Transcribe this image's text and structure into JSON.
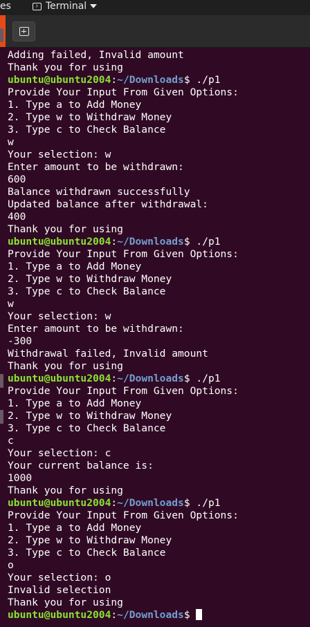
{
  "topbar": {
    "prev_tab_fragment": "es",
    "app_name": "Terminal"
  },
  "prompt": {
    "user_host": "ubuntu@ubuntu2004",
    "colon": ":",
    "path": "~/Downloads",
    "dollar": "$"
  },
  "lines": [
    {
      "type": "text",
      "text": "Adding failed, Invalid amount"
    },
    {
      "type": "text",
      "text": "Thank you for using"
    },
    {
      "type": "prompt",
      "cmd": " ./p1"
    },
    {
      "type": "text",
      "text": "Provide Your Input From Given Options:"
    },
    {
      "type": "text",
      "text": "1. Type a to Add Money"
    },
    {
      "type": "text",
      "text": "2. Type w to Withdraw Money"
    },
    {
      "type": "text",
      "text": "3. Type c to Check Balance"
    },
    {
      "type": "text",
      "text": "w"
    },
    {
      "type": "text",
      "text": "Your selection: w"
    },
    {
      "type": "text",
      "text": "Enter amount to be withdrawn:"
    },
    {
      "type": "text",
      "text": "600"
    },
    {
      "type": "text",
      "text": "Balance withdrawn successfully"
    },
    {
      "type": "text",
      "text": "Updated balance after withdrawal:"
    },
    {
      "type": "text",
      "text": "400"
    },
    {
      "type": "text",
      "text": "Thank you for using"
    },
    {
      "type": "prompt",
      "cmd": " ./p1"
    },
    {
      "type": "text",
      "text": "Provide Your Input From Given Options:"
    },
    {
      "type": "text",
      "text": "1. Type a to Add Money"
    },
    {
      "type": "text",
      "text": "2. Type w to Withdraw Money"
    },
    {
      "type": "text",
      "text": "3. Type c to Check Balance"
    },
    {
      "type": "text",
      "text": "w"
    },
    {
      "type": "text",
      "text": "Your selection: w"
    },
    {
      "type": "text",
      "text": "Enter amount to be withdrawn:"
    },
    {
      "type": "text",
      "text": "-300"
    },
    {
      "type": "text",
      "text": "Withdrawal failed, Invalid amount"
    },
    {
      "type": "text",
      "text": "Thank you for using"
    },
    {
      "type": "prompt",
      "cmd": " ./p1"
    },
    {
      "type": "text",
      "text": "Provide Your Input From Given Options:"
    },
    {
      "type": "text",
      "text": "1. Type a to Add Money"
    },
    {
      "type": "text",
      "text": "2. Type w to Withdraw Money"
    },
    {
      "type": "text",
      "text": "3. Type c to Check Balance"
    },
    {
      "type": "text",
      "text": "c"
    },
    {
      "type": "text",
      "text": "Your selection: c"
    },
    {
      "type": "text",
      "text": "Your current balance is:"
    },
    {
      "type": "text",
      "text": "1000"
    },
    {
      "type": "text",
      "text": "Thank you for using"
    },
    {
      "type": "prompt",
      "cmd": " ./p1"
    },
    {
      "type": "text",
      "text": "Provide Your Input From Given Options:"
    },
    {
      "type": "text",
      "text": "1. Type a to Add Money"
    },
    {
      "type": "text",
      "text": "2. Type w to Withdraw Money"
    },
    {
      "type": "text",
      "text": "3. Type c to Check Balance"
    },
    {
      "type": "text",
      "text": "o"
    },
    {
      "type": "text",
      "text": "Your selection: o"
    },
    {
      "type": "text",
      "text": "Invalid selection"
    },
    {
      "type": "text",
      "text": "Thank you for using"
    },
    {
      "type": "prompt",
      "cmd": " ",
      "cursor": true
    }
  ],
  "colors": {
    "background": "#300a24",
    "prompt_user": "#8ae234",
    "prompt_path": "#729fcf",
    "text": "#ffffff"
  },
  "icons": {
    "app": "terminal-icon",
    "caret": "chevron-down-icon",
    "new_tab": "new-tab-icon"
  }
}
